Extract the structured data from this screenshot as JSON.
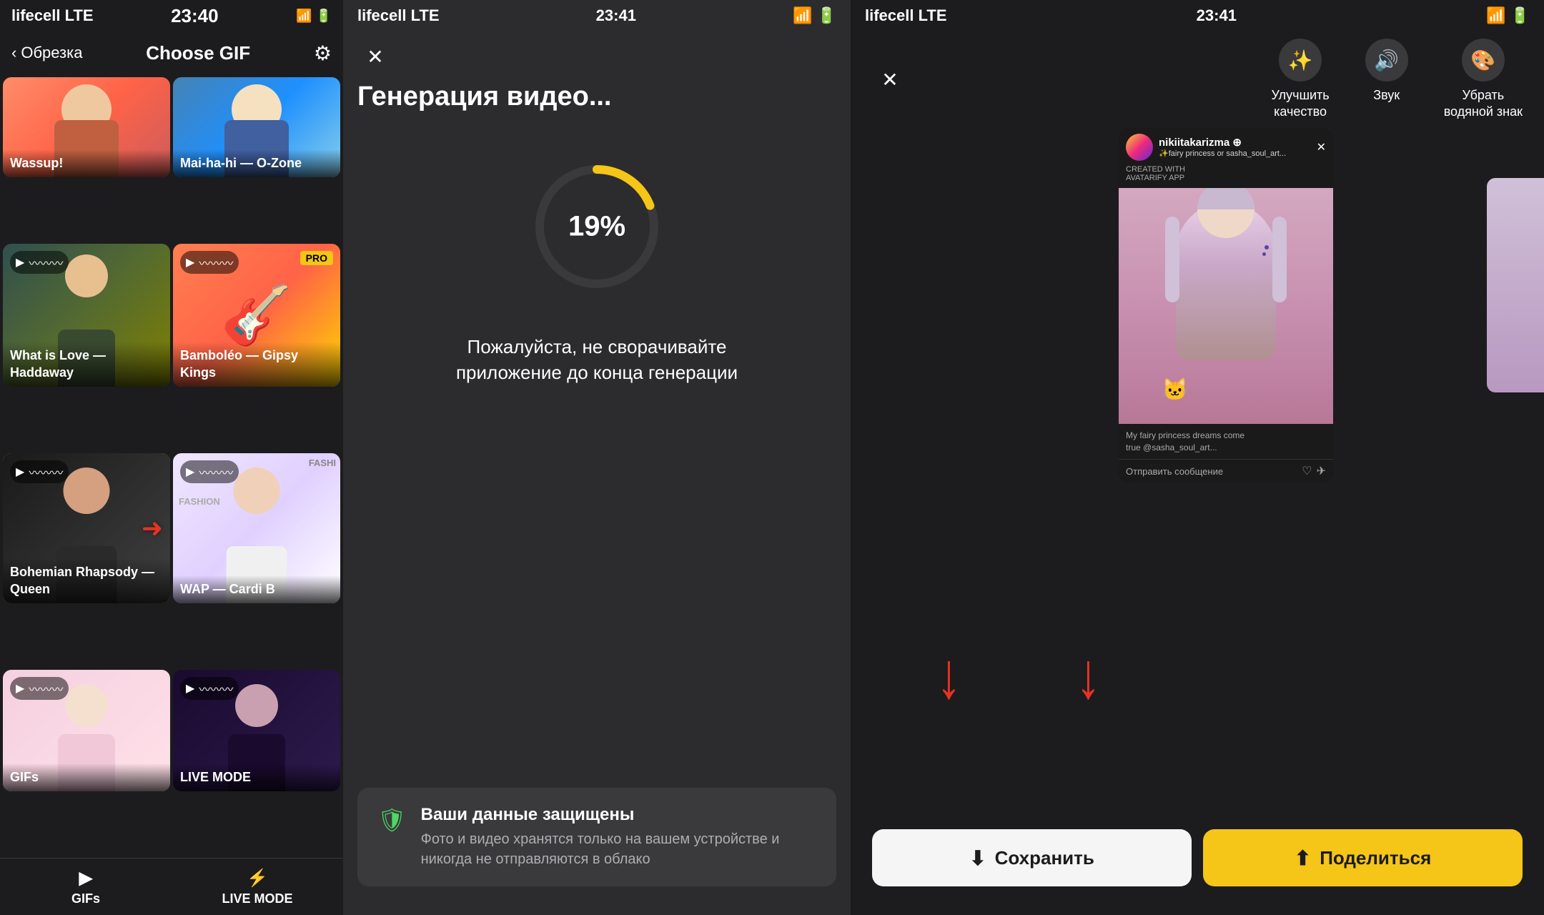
{
  "panel1": {
    "status": {
      "carrier": "lifecell  LTE",
      "time": "23:40",
      "battery": "▮▮▮▯"
    },
    "nav": {
      "back_label": "Обрезка",
      "title": "Choose GIF",
      "gear_icon": "⚙"
    },
    "gifs": [
      {
        "id": "wassup",
        "label": "Wassup!",
        "bg": "wassup-bg",
        "has_play": false,
        "selected": false
      },
      {
        "id": "maihahi",
        "label": "Mai-ha-hi — O-Zone",
        "bg": "maihahi-bg",
        "has_play": false,
        "selected": false
      },
      {
        "id": "whatlove",
        "label": "What is Love — Haddaway",
        "bg": "whatlove-bg",
        "has_play": true,
        "selected": false
      },
      {
        "id": "bamboleo",
        "label": "Bamboléo — Gipsy Kings",
        "bg": "bamboleo-bg",
        "has_play": true,
        "pro": true,
        "selected": false
      },
      {
        "id": "queen",
        "label": "Bohemian Rhapsody — Queen",
        "bg": "queen-bg",
        "has_play": true,
        "selected": true,
        "has_arrow": true
      },
      {
        "id": "wap",
        "label": "WAP — Cardi B",
        "bg": "wap-bg",
        "has_play": true,
        "selected": false
      },
      {
        "id": "gifs",
        "label": "GIFs",
        "bg": "gifs-bg",
        "has_play": true,
        "selected": false
      },
      {
        "id": "live",
        "label": "LIVE MODE",
        "bg": "live-bg",
        "has_play": true,
        "selected": false
      }
    ],
    "tabs": [
      {
        "id": "gifs-tab",
        "icon": "▶",
        "label": "GIFs"
      },
      {
        "id": "live-tab",
        "icon": "⚡",
        "label": "LIVE MODE"
      }
    ]
  },
  "panel2": {
    "status": {
      "carrier": "lifecell  LTE",
      "time": "23:41"
    },
    "close_icon": "✕",
    "title": "Генерация видео...",
    "progress_percent": 19,
    "progress_text": "19%",
    "subtitle_line1": "Пожалуйста, не сворачивайте",
    "subtitle_line2": "приложение до конца генерации",
    "security": {
      "title": "Ваши данные защищены",
      "description": "Фото и видео хранятся только на вашем устройстве и никогда не отправляются в облако"
    }
  },
  "panel3": {
    "status": {
      "carrier": "lifecell  LTE",
      "time": "23:41"
    },
    "close_icon": "✕",
    "tools": [
      {
        "id": "enhance",
        "icon": "✨",
        "label": "Улучшить\nкачество"
      },
      {
        "id": "sound",
        "icon": "🔊",
        "label": "Звук"
      },
      {
        "id": "watermark",
        "icon": "🎨",
        "label": "Убрать\nводяной знак"
      }
    ],
    "preview": {
      "username": "nikiitakarizma",
      "user_full": "nikiitakarizma ⊕...",
      "subtitle": "✨fairy princess or sasha_soul_art...",
      "badge": "CREATED WITH\nAVATARIFY APP",
      "caption": "My fairy princess dreams come\ntrue @sasha_soul_art...",
      "send_message": "Отправить сообщение"
    },
    "arrows": [
      "↓",
      "↓"
    ],
    "buttons": {
      "save_label": "Сохранить",
      "share_label": "Поделиться",
      "save_icon": "⬇",
      "share_icon": "⬆"
    }
  }
}
